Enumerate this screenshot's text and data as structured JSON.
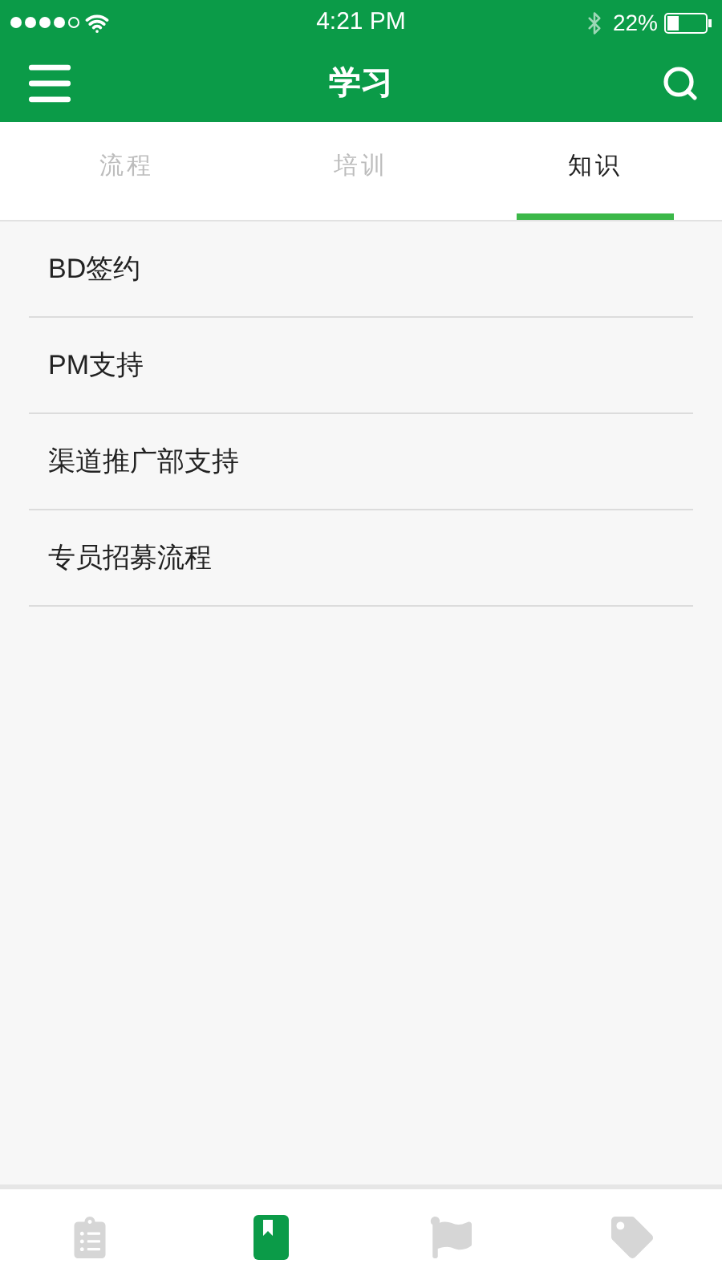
{
  "status_bar": {
    "time": "4:21 PM",
    "battery": "22%"
  },
  "nav": {
    "title": "学习"
  },
  "tabs": [
    {
      "label": "流程",
      "selected": false
    },
    {
      "label": "培训",
      "selected": false
    },
    {
      "label": "知识",
      "selected": true
    }
  ],
  "list": [
    "BD签约",
    "PM支持",
    "渠道推广部支持",
    "专员招募流程"
  ],
  "bottom_tabs": [
    {
      "kind": "clipboard",
      "selected": false
    },
    {
      "kind": "book",
      "selected": true
    },
    {
      "kind": "flag",
      "selected": false
    },
    {
      "kind": "tag",
      "selected": false
    }
  ]
}
